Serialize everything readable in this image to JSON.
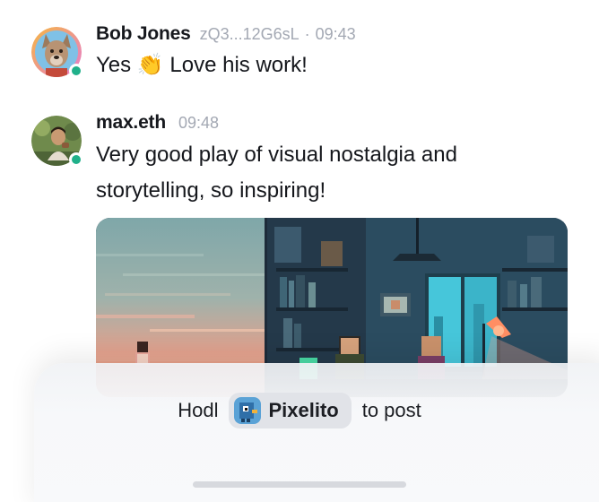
{
  "messages": [
    {
      "author": "Bob Jones",
      "handle": "zQ3...12G6sL",
      "separator": "·",
      "time": "09:43",
      "text_before": "Yes",
      "emoji": "👏",
      "text_after": "Love his work!",
      "avatar": "dog-avatar",
      "online": true
    },
    {
      "author": "max.eth",
      "time": "09:48",
      "text_line1": "Very good play of visual nostalgia and",
      "text_line2": "storytelling, so inspiring!",
      "avatar": "person-avatar",
      "online": true,
      "attachments": [
        "pixel-art-sunset-image",
        "pixel-art-room-image"
      ]
    }
  ],
  "token_gate": {
    "prefix": "Hodl",
    "token_name": "Pixelito",
    "suffix": "to post",
    "token_icon": "pixel-bird-icon"
  },
  "colors": {
    "online": "#20b08a",
    "muted": "#a3a8b3",
    "chip": "#e1e3e8"
  }
}
